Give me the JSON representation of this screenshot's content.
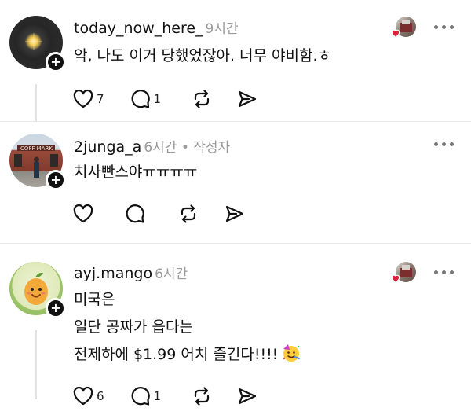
{
  "posts": [
    {
      "username": "today_now_here_",
      "time": "9시간",
      "author_tag": "",
      "lines": [
        "악, 나도 이거 당했었잖아. 너무 야비함.ㅎ"
      ],
      "like_count": "7",
      "reply_count": "1"
    },
    {
      "username": "2junga_a",
      "time": "6시간",
      "author_tag": " • 작성자",
      "lines": [
        "치사빤스야ㅠㅠㅠㅠ"
      ],
      "like_count": "",
      "reply_count": ""
    },
    {
      "username": "ayj.mango",
      "time": "6시간",
      "author_tag": "",
      "lines": [
        "미국은",
        "일단 공짜가 읍다는",
        "전제하에 $1.99 어치 즐긴다!!!!"
      ],
      "like_count": "6",
      "reply_count": "1"
    }
  ],
  "icons": {
    "like": "heart-icon",
    "reply": "comment-icon",
    "repost": "repost-icon",
    "share": "send-icon",
    "more": "more-icon",
    "follow": "plus-icon",
    "party": "party-face-icon"
  },
  "colors": {
    "muted": "#9a9a9a",
    "text": "#111111",
    "heart": "#e0203a"
  }
}
